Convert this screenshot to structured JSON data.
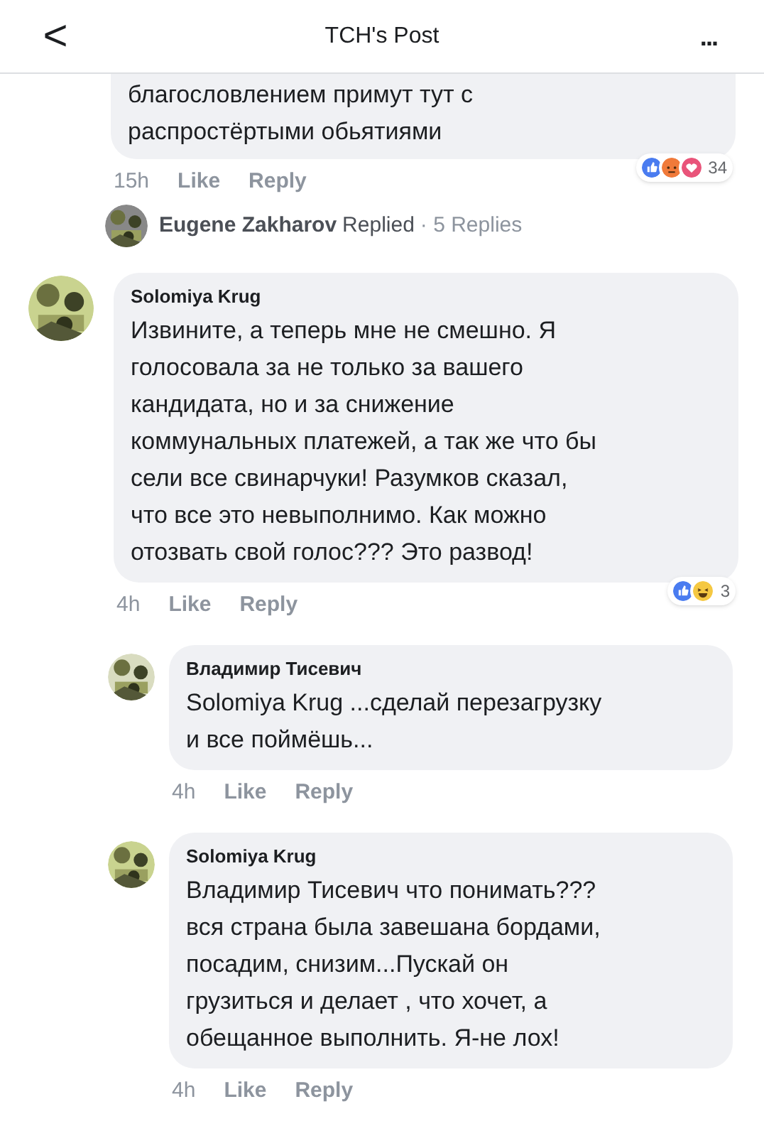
{
  "header": {
    "back": "<",
    "title": "TCH's Post",
    "more": "..."
  },
  "comments": [
    {
      "kind": "partial",
      "text": "благословлением примут тут с\nраспростёртыми обьятиями",
      "time": "15h",
      "like": "Like",
      "reply": "Reply",
      "reactions": [
        {
          "kind": "like"
        },
        {
          "kind": "angry"
        },
        {
          "kind": "love"
        }
      ],
      "reaction_count": "34",
      "replied": {
        "name": "Eugene Zakharov",
        "action": "Replied",
        "count": "· 5 Replies"
      }
    },
    {
      "kind": "top",
      "name": "Solomiya Krug",
      "text": "Извините, а теперь мне не смешно. Я\nголосовала за не только за вашего\nкандидата, но и за снижение\nкоммунальных платежей, а так же что бы\nсели все свинарчуки! Разумков сказал,\nчто все это невыполнимо. Как можно\nотозвать свой голос??? Это развод!",
      "time": "4h",
      "like": "Like",
      "reply": "Reply",
      "reactions": [
        {
          "kind": "like"
        },
        {
          "kind": "haha"
        }
      ],
      "reaction_count": "3"
    },
    {
      "kind": "reply",
      "name": "Владимир Тисевич",
      "text": "Solomiya Krug ...сделай перезагрузку\nи все поймёшь...",
      "time": "4h",
      "like": "Like",
      "reply": "Reply"
    },
    {
      "kind": "reply",
      "name": "Solomiya Krug",
      "text": "Владимир Тисевич что понимать???\nвся страна была завешана бордами,\nпосадим, снизим...Пускай он\nгрузиться и делает , что хочет, а\nобещанное выполнить. Я-не лох!",
      "time": "4h",
      "like": "Like",
      "reply": "Reply"
    }
  ]
}
